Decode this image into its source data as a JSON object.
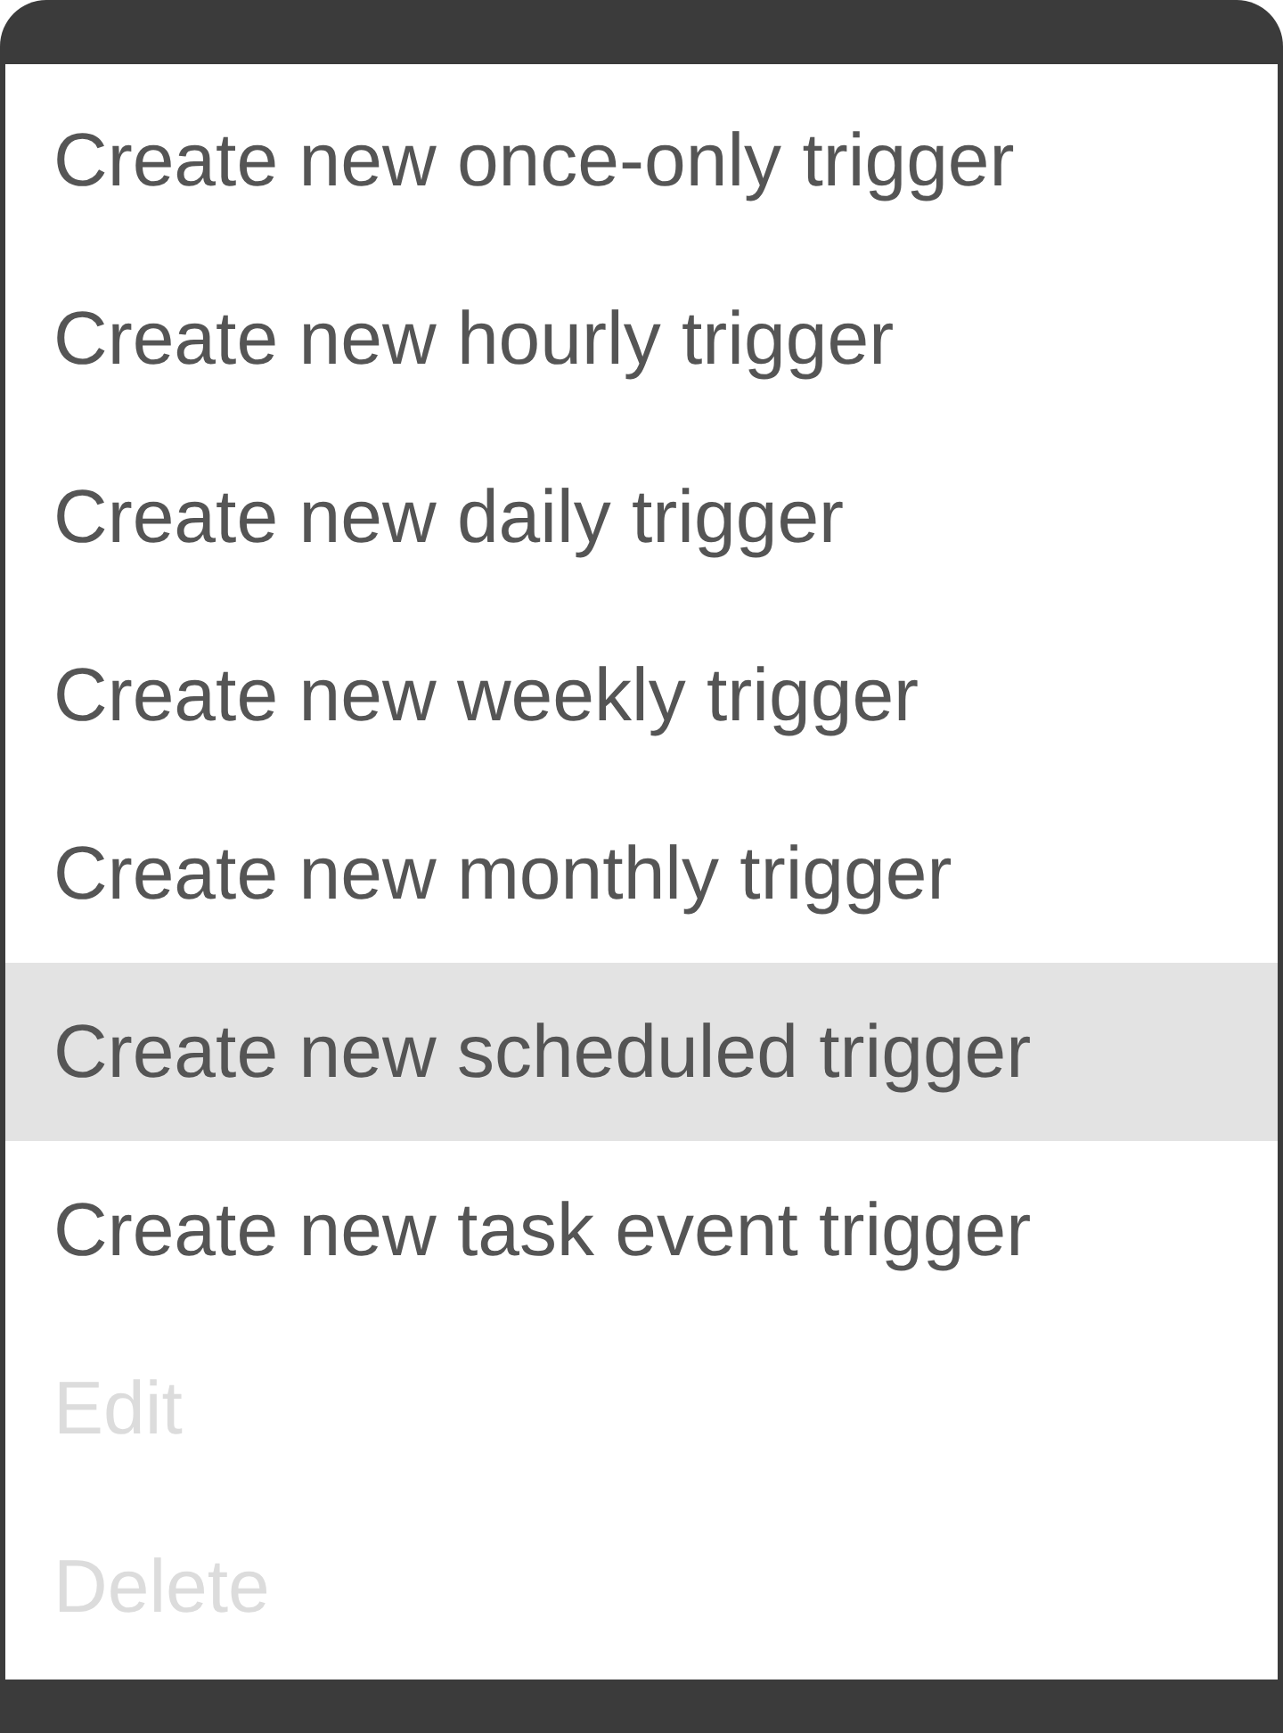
{
  "menu": {
    "items": [
      {
        "label": "Create new once-only trigger",
        "selected": false,
        "disabled": false
      },
      {
        "label": "Create new hourly trigger",
        "selected": false,
        "disabled": false
      },
      {
        "label": "Create new daily trigger",
        "selected": false,
        "disabled": false
      },
      {
        "label": "Create new weekly trigger",
        "selected": false,
        "disabled": false
      },
      {
        "label": "Create new monthly trigger",
        "selected": false,
        "disabled": false
      },
      {
        "label": "Create new scheduled trigger",
        "selected": true,
        "disabled": false
      },
      {
        "label": "Create new task event trigger",
        "selected": false,
        "disabled": false
      },
      {
        "label": "Edit",
        "selected": false,
        "disabled": true
      },
      {
        "label": "Delete",
        "selected": false,
        "disabled": true
      }
    ]
  }
}
